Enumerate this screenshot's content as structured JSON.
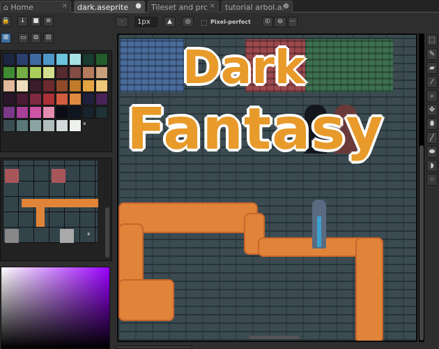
{
  "tabs": [
    {
      "label": "Home",
      "icon": "home-icon",
      "close": "×"
    },
    {
      "label": "dark.aseprite",
      "close": "●"
    },
    {
      "label": "Tileset and prc",
      "close": "×"
    },
    {
      "label": "tutorial arbol.a:",
      "close": "●"
    }
  ],
  "toolbar": {
    "brush_size": "1px",
    "pixel_perfect_label": "Pixel-perfect",
    "pixel_perfect_checked": false,
    "more": "···",
    "dot": "·"
  },
  "palette": {
    "colors": [
      "#1b2540",
      "#2a3f6e",
      "#3e6aa0",
      "#4f97c8",
      "#6cc3de",
      "#a8e2e4",
      "#183a30",
      "#255c2c",
      "#3f8a33",
      "#74ae44",
      "#a9cf5a",
      "#d3df8e",
      "#552b30",
      "#824c45",
      "#b57b5c",
      "#c9a07c",
      "#e2b99c",
      "#efdcbc",
      "#3c1e2a",
      "#6c2a2e",
      "#8f4a2a",
      "#c07a2a",
      "#e4a442",
      "#edc677",
      "#2a1628",
      "#4a1c34",
      "#7e2a40",
      "#aa3236",
      "#d35c40",
      "#df8a40",
      "#20203e",
      "#482458",
      "#7a3a88",
      "#a8409a",
      "#cc55a6",
      "#e48db0",
      "#0c0c14",
      "#101620",
      "#18222c",
      "#203236",
      "#3a4e52",
      "#5a787a",
      "#8aa4a2",
      "#b0bebe",
      "#d2dada",
      "#eef0ec"
    ],
    "resize_handle": "⏸"
  },
  "tileset": {
    "resize_handle": "⏸"
  },
  "canvas": {
    "title_line1": "Dark",
    "title_line2": "Fantasy"
  },
  "tools": [
    "select-icon",
    "pencil-icon",
    "eraser-icon",
    "eyedropper-icon",
    "zoom-icon",
    "move-icon",
    "fill-icon",
    "line-icon",
    "ellipse-icon",
    "contour-icon",
    "spray-icon"
  ]
}
